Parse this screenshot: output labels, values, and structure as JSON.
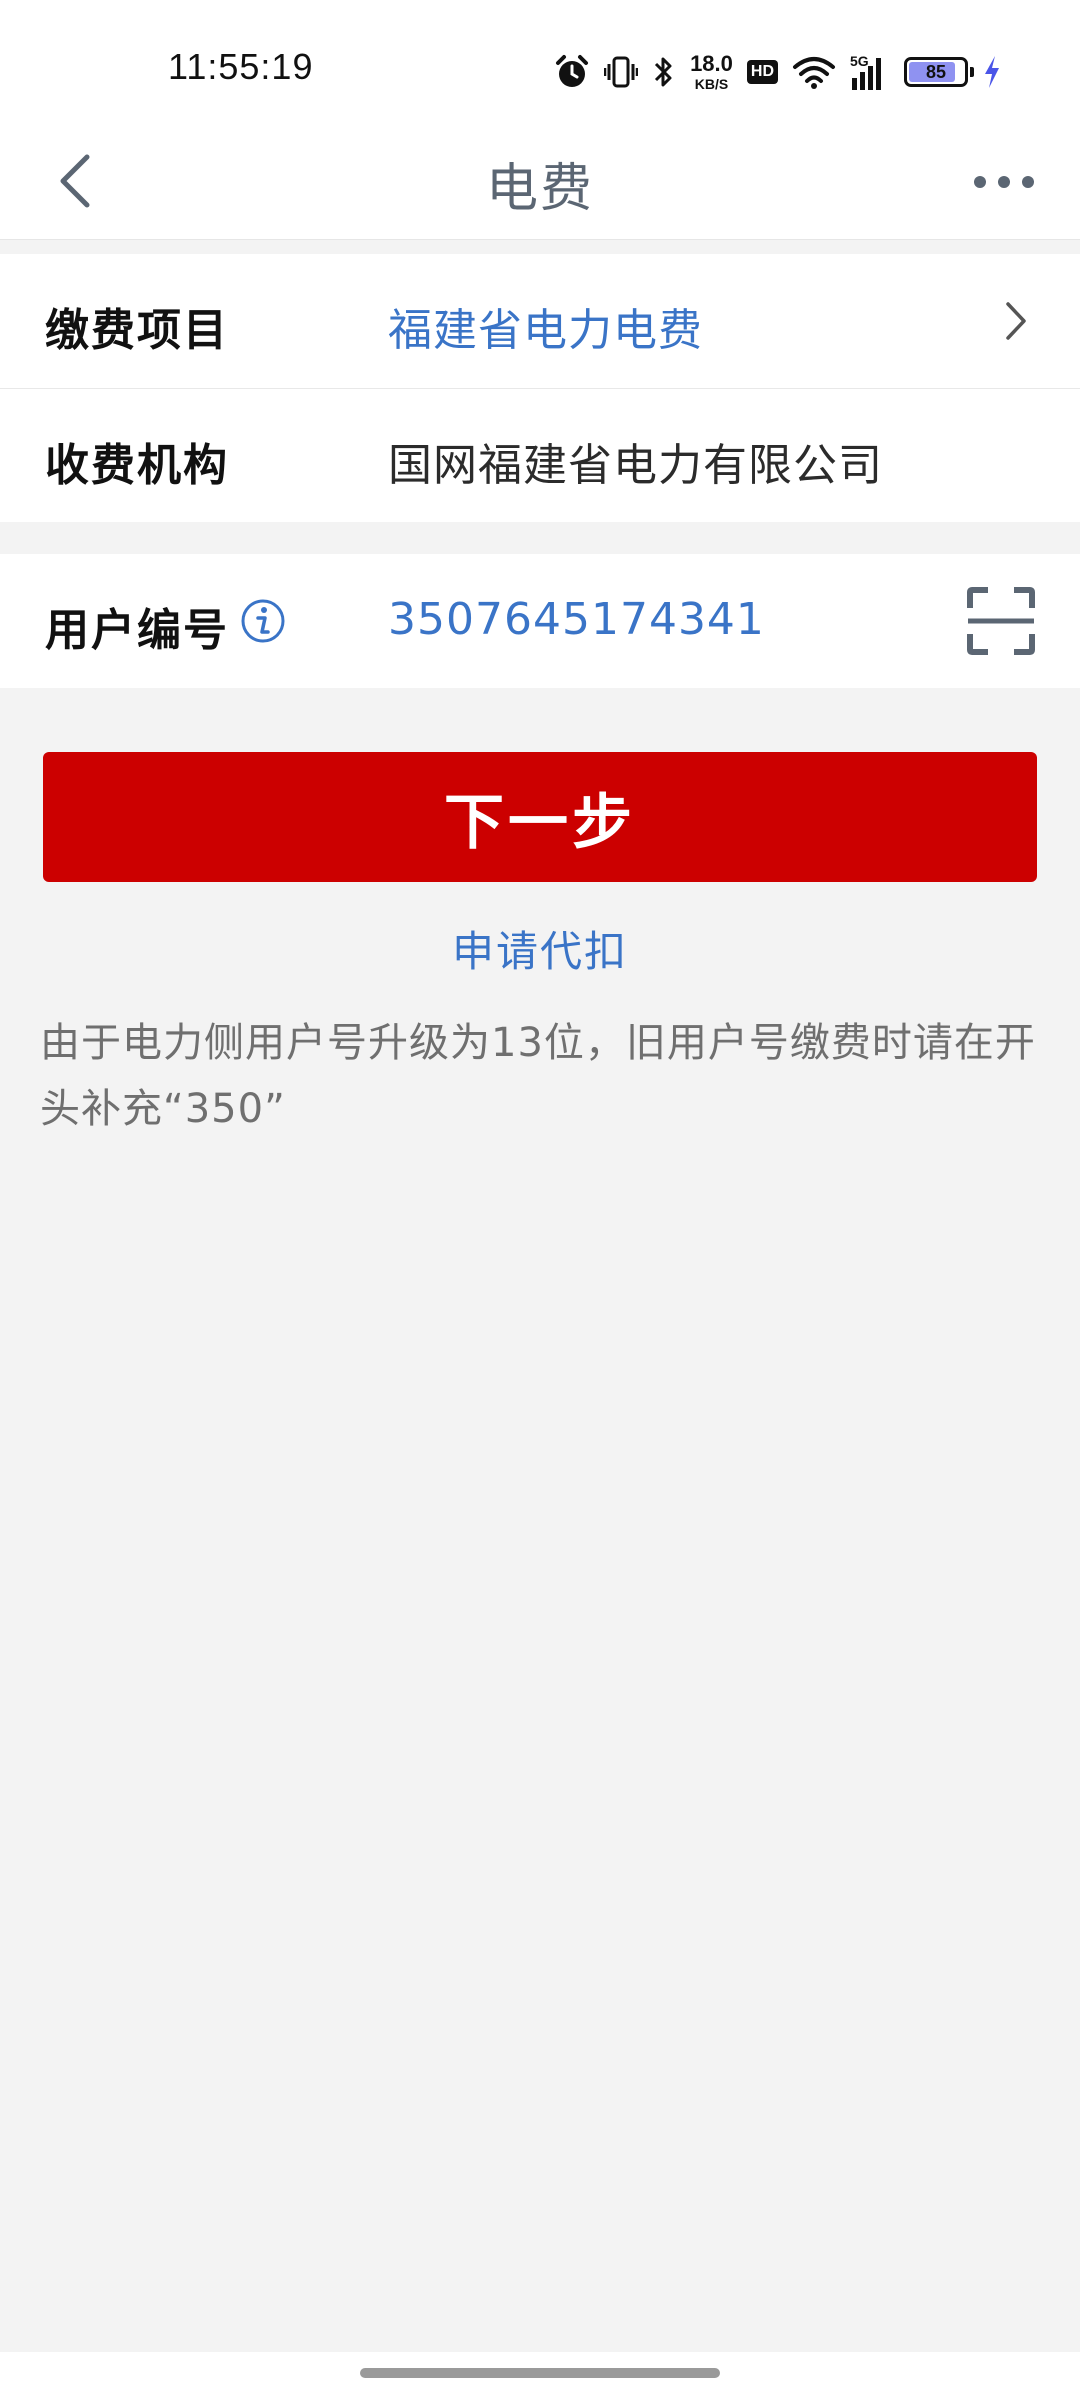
{
  "status_bar": {
    "time": "11:55:19",
    "net_speed_value": "18.0",
    "net_speed_unit": "KB/S",
    "hd_label": "HD",
    "network_label": "5G",
    "battery_level": "85",
    "battery_fraction": 0.85,
    "battery_fill_color": "#8f92f1",
    "charging_color": "#4a55e8",
    "icons": [
      "alarm-icon",
      "vibrate-icon",
      "bluetooth-icon",
      "wifi-icon",
      "signal-icon",
      "battery-icon",
      "charging-icon"
    ]
  },
  "nav": {
    "title": "电费",
    "back_icon": "chevron-left-icon",
    "more_icon": "more-dots-icon"
  },
  "form": {
    "payment_item_label": "缴费项目",
    "payment_item_value": "福建省电力电费",
    "institution_label": "收费机构",
    "institution_value": "国网福建省电力有限公司",
    "user_number_label": "用户编号",
    "user_number_value": "3507645174341"
  },
  "actions": {
    "next_label": "下一步",
    "next_color": "#cc0000",
    "apply_label": "申请代扣"
  },
  "notice": {
    "text": "由于电力侧用户号升级为13位，旧用户号缴费时请在开头补充“350”"
  },
  "colors": {
    "accent_blue": "#3a74c7",
    "background": "#f3f3f3"
  }
}
